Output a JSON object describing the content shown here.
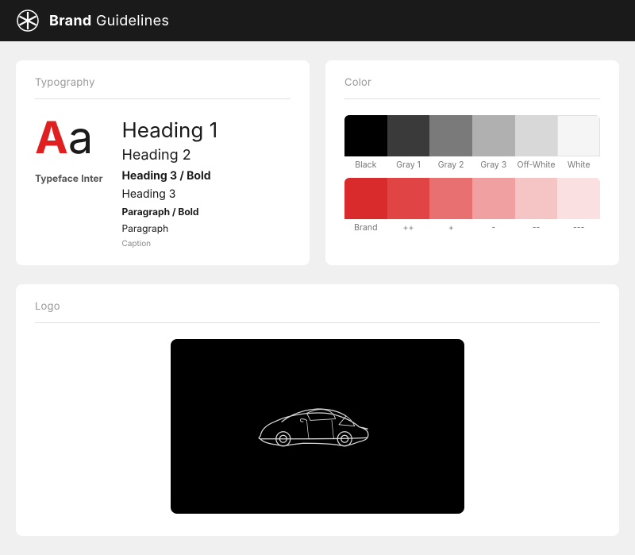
{
  "header": {
    "title_bold": "Brand",
    "title_light": " Guidelines",
    "logo_label": "asterisk-logo"
  },
  "typography": {
    "section_title": "Typography",
    "heading1": "Heading 1",
    "heading2": "Heading 2",
    "heading3_bold": "Heading 3 / Bold",
    "heading3": "Heading 3",
    "paragraph_bold": "Paragraph / Bold",
    "paragraph": "Paragraph",
    "caption": "Caption",
    "sample_letters": "Aa",
    "letter_red": "A",
    "letter_black": "a",
    "typeface_label": "Typeface",
    "typeface_name": "Inter"
  },
  "color": {
    "section_title": "Color",
    "gray_swatches": [
      {
        "label": "Black",
        "hex": "#000000"
      },
      {
        "label": "Gray 1",
        "hex": "#3a3a3a"
      },
      {
        "label": "Gray 2",
        "hex": "#7a7a7a"
      },
      {
        "label": "Gray 3",
        "hex": "#b0b0b0"
      },
      {
        "label": "Off-White",
        "hex": "#d8d8d8"
      },
      {
        "label": "White",
        "hex": "#f5f5f5"
      }
    ],
    "brand_swatches": [
      {
        "label": "Brand",
        "hex": "#d92b2b"
      },
      {
        "label": "++",
        "hex": "#e04444"
      },
      {
        "label": "+",
        "hex": "#e87070"
      },
      {
        "label": "-",
        "hex": "#f0a0a0"
      },
      {
        "label": "--",
        "hex": "#f5c5c5"
      },
      {
        "label": "---",
        "hex": "#fae0e0"
      }
    ]
  },
  "logo": {
    "section_title": "Logo"
  }
}
